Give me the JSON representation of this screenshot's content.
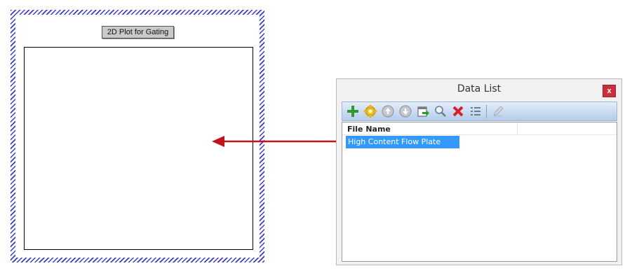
{
  "plot_panel": {
    "title_button": "2D Plot for Gating"
  },
  "data_list_window": {
    "title": "Data List",
    "close_label": "x",
    "toolbar": {
      "buttons": [
        "add-icon",
        "settings-gear-icon",
        "move-up-icon",
        "move-down-icon",
        "export-icon",
        "search-icon",
        "delete-icon",
        "properties-icon",
        "edit-icon"
      ]
    },
    "list": {
      "column_header": "File Name",
      "rows": [
        "High Content Flow Plate Data"
      ]
    }
  },
  "colors": {
    "arrow": "#c0141b",
    "selection": "#3399ff",
    "hatch": "#3a3ad0",
    "close_button": "#c8303a"
  }
}
